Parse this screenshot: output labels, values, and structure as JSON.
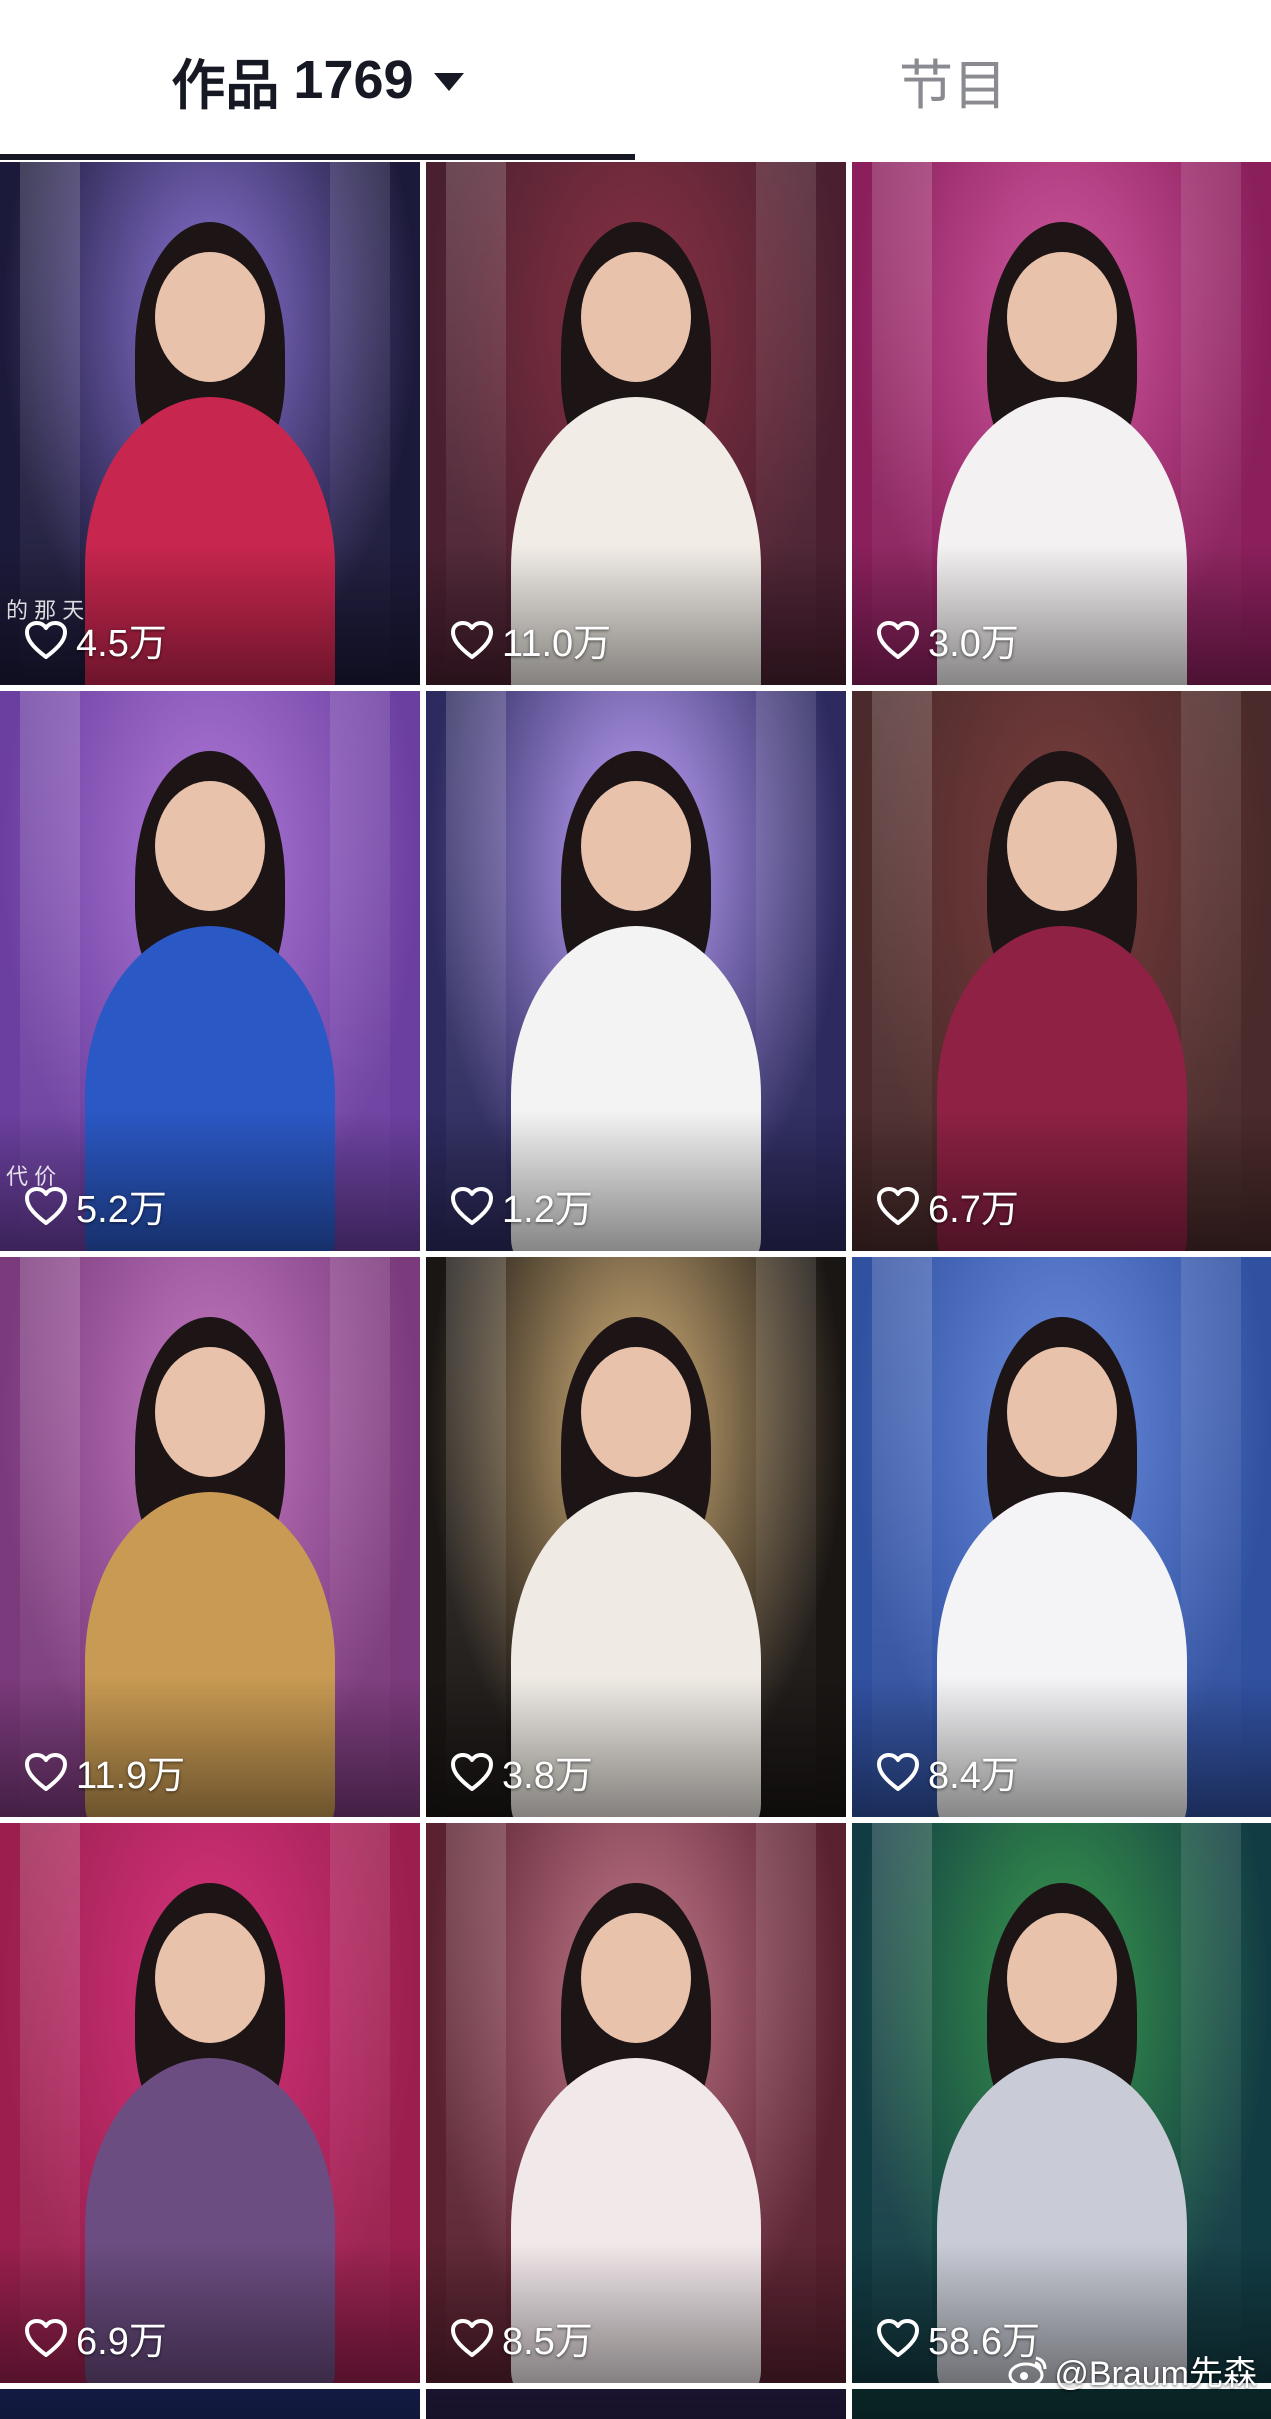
{
  "tabs": {
    "works_label": "作品",
    "works_count": "1769",
    "shows_label": "节目"
  },
  "videos": [
    {
      "likes": "4.5万",
      "caption": "的 那 天",
      "bg": "#1c1a3a",
      "accent": "#8e76d8",
      "figure": "#c7264e"
    },
    {
      "likes": "11.0万",
      "bg": "#4a2030",
      "accent": "#8a3244",
      "figure": "#f1ece6"
    },
    {
      "likes": "3.0万",
      "bg": "#8a1f5c",
      "accent": "#d15aa1",
      "figure": "#f4f1f2"
    },
    {
      "likes": "5.2万",
      "caption": "代 价",
      "bg": "#6b3fa0",
      "accent": "#b07ad8",
      "figure": "#2a58c4"
    },
    {
      "likes": "1.2万",
      "bg": "#2c2a5e",
      "accent": "#c4a6ff",
      "figure": "#f3f3f3"
    },
    {
      "likes": "6.7万",
      "bg": "#4a2a2a",
      "accent": "#7a3d3d",
      "figure": "#8e2144"
    },
    {
      "likes": "11.9万",
      "bg": "#7b3a7c",
      "accent": "#c47bc2",
      "figure": "#c89a53"
    },
    {
      "likes": "3.8万",
      "bg": "#1a1614",
      "accent": "#d9b67c",
      "figure": "#efeae4"
    },
    {
      "likes": "8.4万",
      "bg": "#3050a0",
      "accent": "#6d8ee0",
      "figure": "#f4f4f6"
    },
    {
      "likes": "6.9万",
      "bg": "#9a1f4e",
      "accent": "#d9347e",
      "figure": "#6c4d82"
    },
    {
      "likes": "8.5万",
      "bg": "#5a2130",
      "accent": "#c27a8c",
      "figure": "#f1e8ea"
    },
    {
      "likes": "58.6万",
      "bg": "#123c44",
      "accent": "#3a9a4c",
      "figure": "#c9ccd6"
    }
  ],
  "watermark": {
    "text": "@Braum先森"
  },
  "colors": {
    "tab_active": "#161823",
    "tab_inactive": "#8a8b91",
    "like_text": "#ffffff"
  }
}
